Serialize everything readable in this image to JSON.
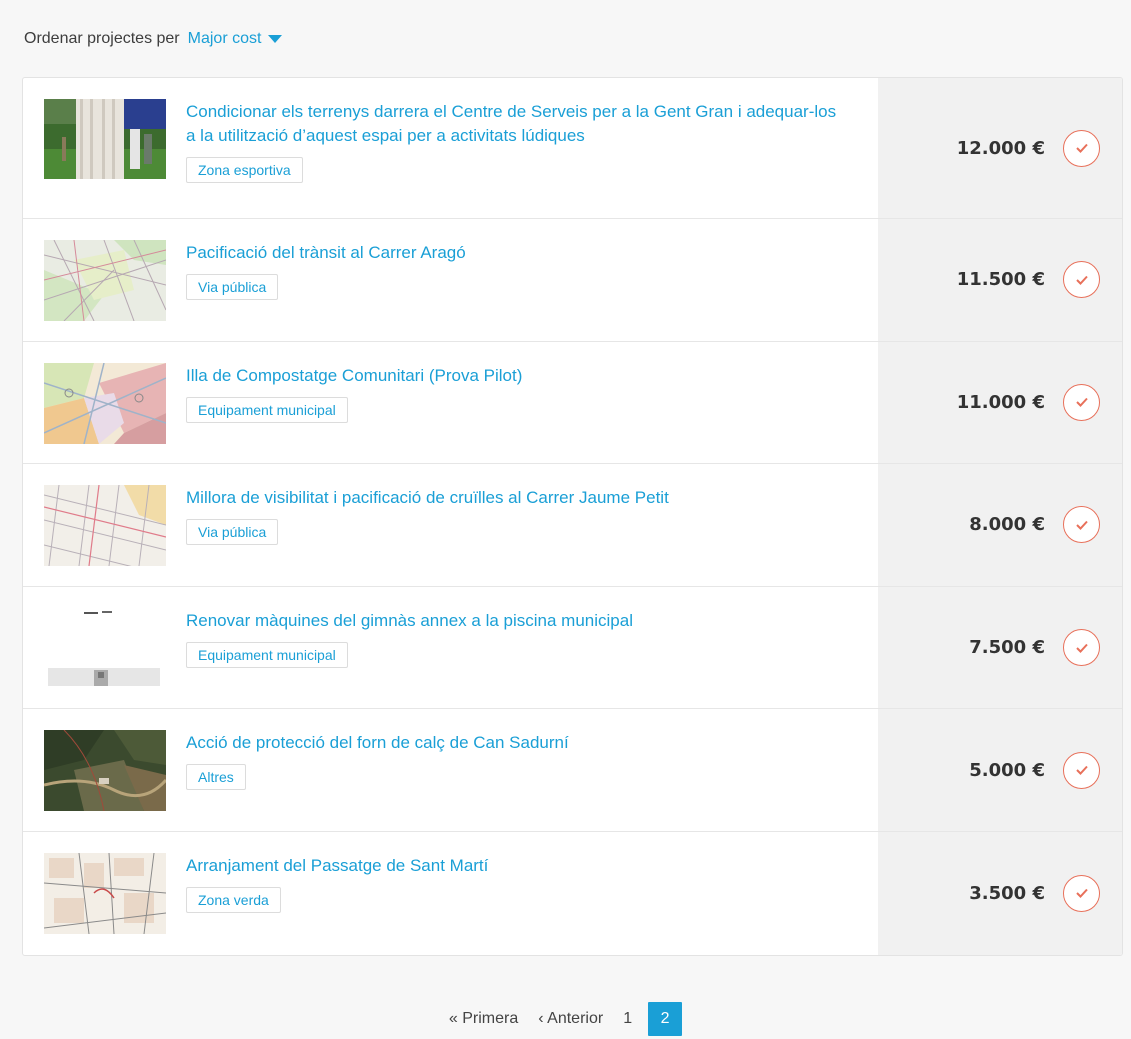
{
  "sort": {
    "label": "Ordenar projectes per",
    "value": "Major cost"
  },
  "projects": [
    {
      "title": "Condicionar els terrenys darrera el Centre de Serveis per a la Gent Gran i adequar-los a la utilització d’aquest espai per a activitats lúdiques",
      "tag": "Zona esportiva",
      "amount": "12.000 €"
    },
    {
      "title": "Pacificació del trànsit al Carrer Aragó",
      "tag": "Via pública",
      "amount": "11.500 €"
    },
    {
      "title": "Illa de Compostatge Comunitari (Prova Pilot)",
      "tag": "Equipament municipal",
      "amount": "11.000 €"
    },
    {
      "title": "Millora de visibilitat i pacificació de cruïlles al Carrer Jaume Petit",
      "tag": "Via pública",
      "amount": "8.000 €"
    },
    {
      "title": "Renovar màquines del gimnàs annex a la piscina municipal",
      "tag": "Equipament municipal",
      "amount": "7.500 €"
    },
    {
      "title": "Acció de protecció del forn de calç de Can Sadurní",
      "tag": "Altres",
      "amount": "5.000 €"
    },
    {
      "title": "Arranjament del Passatge de Sant Martí",
      "tag": "Zona verda",
      "amount": "3.500 €"
    }
  ],
  "pagination": {
    "first": "« Primera",
    "prev": "‹ Anterior",
    "pages": [
      "1",
      "2"
    ]
  },
  "colors": {
    "accent": "#1a9fd6",
    "check": "#e8705a"
  }
}
